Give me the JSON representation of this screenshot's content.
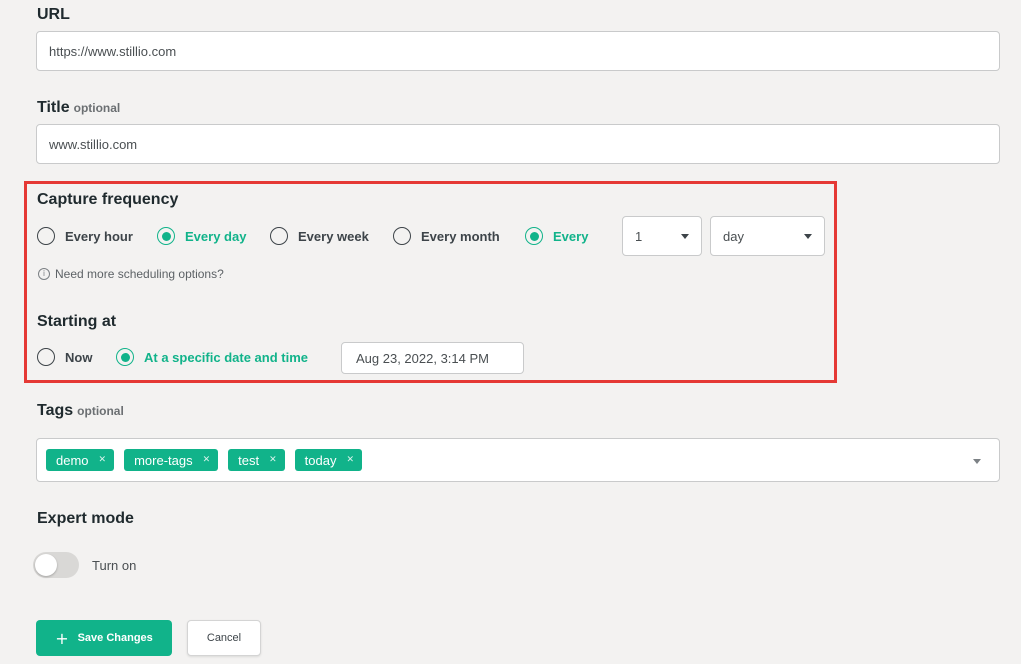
{
  "url": {
    "label": "URL",
    "value": "https://www.stillio.com"
  },
  "title": {
    "label": "Title",
    "optional": "optional",
    "value": "www.stillio.com"
  },
  "capture_frequency": {
    "label": "Capture frequency",
    "options": [
      {
        "label": "Every hour",
        "checked": false
      },
      {
        "label": "Every day",
        "checked": true
      },
      {
        "label": "Every week",
        "checked": false
      },
      {
        "label": "Every month",
        "checked": false
      },
      {
        "label": "Every",
        "checked": true
      }
    ],
    "interval_value": "1",
    "interval_unit": "day",
    "hint": "Need more scheduling options?"
  },
  "starting_at": {
    "label": "Starting at",
    "options": [
      {
        "label": "Now",
        "checked": false
      },
      {
        "label": "At a specific date and time",
        "checked": true
      }
    ],
    "datetime": "Aug 23, 2022, 3:14 PM"
  },
  "tags": {
    "label": "Tags",
    "optional": "optional",
    "items": [
      "demo",
      "more-tags",
      "test",
      "today"
    ]
  },
  "expert_mode": {
    "label": "Expert mode",
    "toggle_label": "Turn on",
    "enabled": false
  },
  "actions": {
    "save_label": "Save Changes",
    "cancel_label": "Cancel"
  },
  "colors": {
    "accent": "#11b38a",
    "highlight": "#e53935",
    "background": "#f3f2f1"
  }
}
